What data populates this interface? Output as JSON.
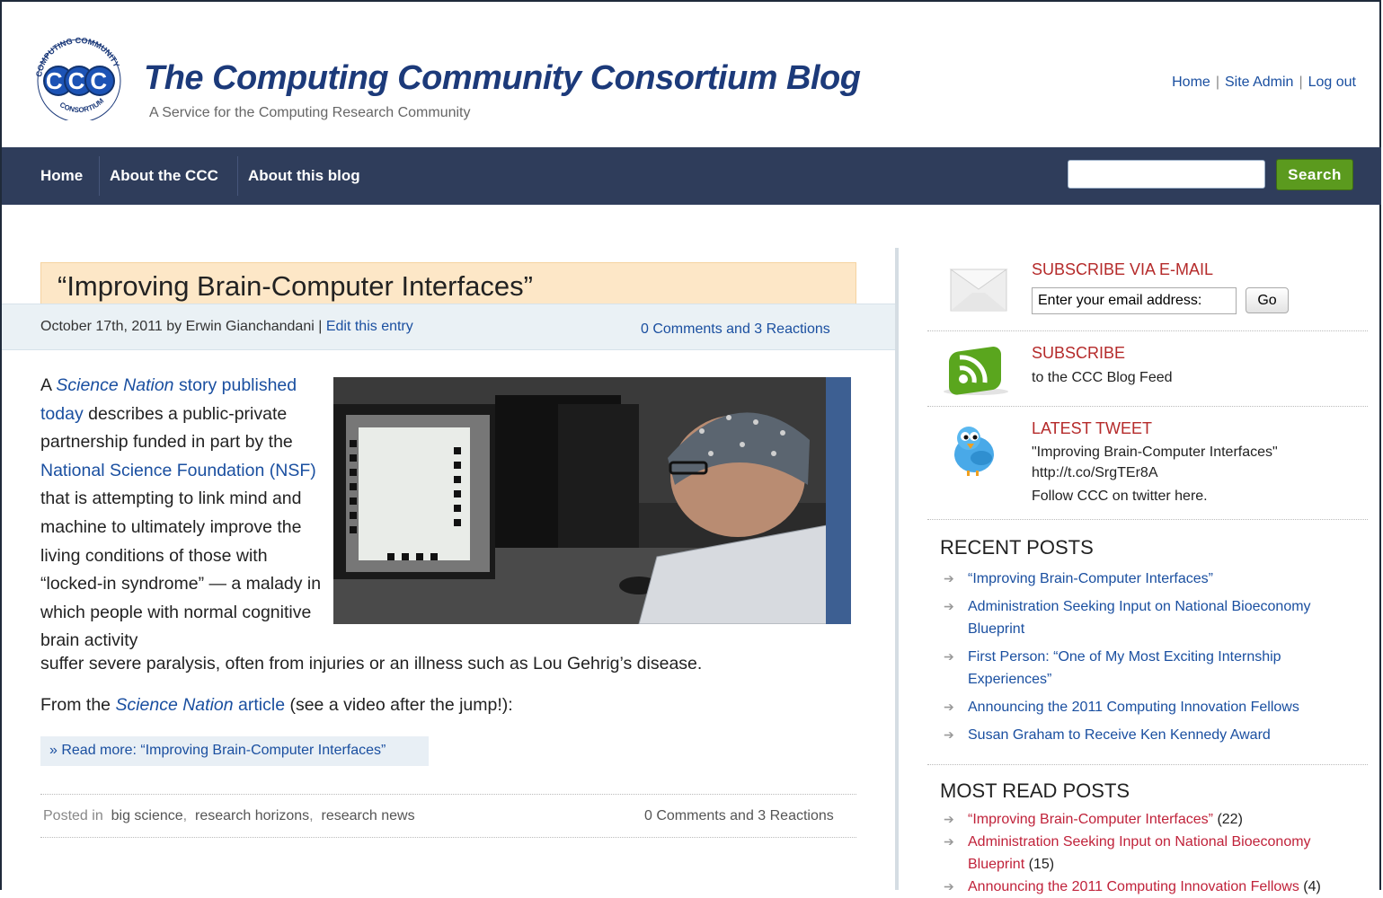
{
  "header": {
    "logo_text": "CCC",
    "logo_ring_top": "COMPUTING COMMUNITY",
    "logo_ring_bottom": "CONSORTIUM",
    "title": "The Computing Community Consortium Blog",
    "tagline": "A Service for the Computing Research Community",
    "top_links": [
      "Home",
      "Site Admin",
      "Log out"
    ],
    "top_links_separator": "|"
  },
  "nav": {
    "items": [
      "Home",
      "About the CCC",
      "About this blog"
    ],
    "search_value": "",
    "search_button": "Search"
  },
  "post": {
    "title": "“Improving Brain-Computer Interfaces”",
    "meta_prefix": "October 17th, 2011 by Erwin Gianchandani | ",
    "edit_link": "Edit this entry",
    "comments_link": "0 Comments and 3 Reactions",
    "body": {
      "p1_a": "A ",
      "p1_link1_ital": "Science Nation",
      "p1_link1_rest": " story published today",
      "p1_b": " describes a public-private partnership funded in part by the ",
      "p1_link2": "National Science Foundation (NSF)",
      "p1_c": " that is attempting to link mind and machine to ultimately improve the living conditions of those with “locked-in syndrome” — a malady in which people with normal cognitive brain activity",
      "p1_d": "suffer severe paralysis, often from injuries or an illness such as Lou Gehrig’s disease.",
      "p2_a": "From the ",
      "p2_link_ital": "Science Nation",
      "p2_link_rest": " article",
      "p2_b": " (see a video after the jump!):"
    },
    "read_more": "» Read more: “Improving Brain-Computer Interfaces”",
    "posted_in_label": "Posted in",
    "categories": [
      "big science",
      "research horizons",
      "research news"
    ],
    "footer_comments": "0 Comments and 3 Reactions"
  },
  "sidebar": {
    "subscribe_email_heading": "SUBSCRIBE VIA E-MAIL",
    "email_placeholder": "Enter your email address:",
    "go_button": "Go",
    "subscribe_heading": "SUBSCRIBE",
    "subscribe_text": "to the CCC Blog Feed",
    "tweet_heading": "LATEST TWEET",
    "tweet_line1": "\"Improving Brain-Computer Interfaces\"",
    "tweet_line2": "http://t.co/SrgTEr8A",
    "tweet_follow": "Follow CCC on twitter here.",
    "recent_heading": "RECENT POSTS",
    "recent_posts": [
      "“Improving Brain-Computer Interfaces”",
      "Administration Seeking Input on National Bioeconomy Blueprint",
      "First Person: “One of My Most Exciting Internship Experiences”",
      "Announcing the 2011 Computing Innovation Fellows",
      "Susan Graham to Receive Ken Kennedy Award"
    ],
    "most_read_heading": "MOST READ POSTS",
    "most_read": [
      {
        "title": "“Improving Brain-Computer Interfaces”",
        "count": "(22)"
      },
      {
        "title": "Administration Seeking Input on National Bioeconomy Blueprint",
        "count": "(15)"
      },
      {
        "title": "Announcing the 2011 Computing Innovation Fellows",
        "count": "(4)"
      }
    ]
  },
  "colors": {
    "nav_bg": "#2f3d5b",
    "title_blue": "#1c3a7a",
    "link_blue": "#1a4fa0",
    "sidebar_heading_red": "#b52a2a",
    "search_green": "#5b9a1e",
    "post_title_bg": "#fde7c7"
  }
}
